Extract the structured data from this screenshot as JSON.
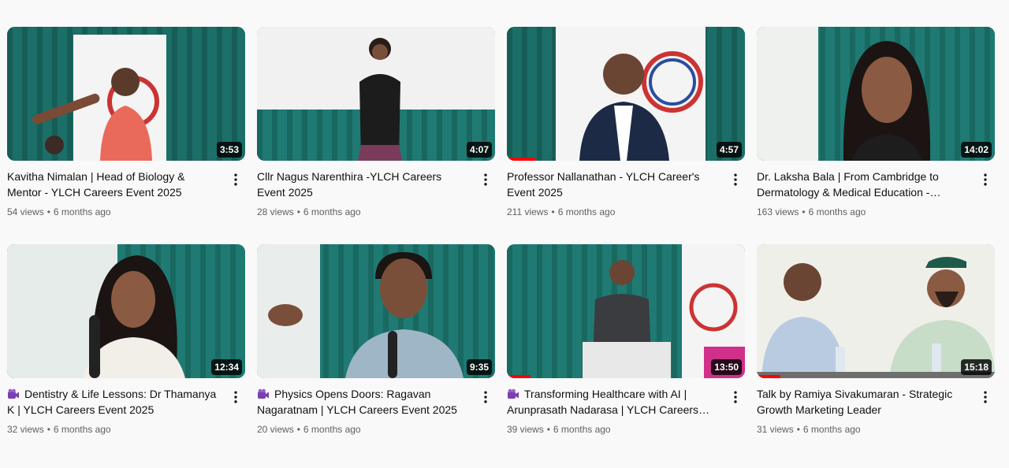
{
  "videos": [
    {
      "title": "Kavitha Nimalan | Head of Biology & Mentor - YLCH Careers Event 2025",
      "views": "54 views",
      "age": "6 months ago",
      "duration": "3:53",
      "has_badge": false,
      "progress": 0,
      "thumb_icon": "kavitha-thumbnail"
    },
    {
      "title": "Cllr Nagus Narenthira -YLCH Careers Event 2025",
      "views": "28 views",
      "age": "6 months ago",
      "duration": "4:07",
      "has_badge": false,
      "progress": 0,
      "thumb_icon": "nagus-thumbnail"
    },
    {
      "title": "Professor Nallanathan - YLCH Career's Event 2025",
      "views": "211 views",
      "age": "6 months ago",
      "duration": "4:57",
      "has_badge": false,
      "progress": 0.12,
      "thumb_icon": "nallanathan-thumbnail"
    },
    {
      "title": "Dr. Laksha Bala | From Cambridge to Dermatology & Medical Education - Career…",
      "views": "163 views",
      "age": "6 months ago",
      "duration": "14:02",
      "has_badge": false,
      "progress": 0,
      "thumb_icon": "laksha-thumbnail"
    },
    {
      "title": "Dentistry & Life Lessons: Dr Thamanya K | YLCH Careers Event 2025",
      "views": "32 views",
      "age": "6 months ago",
      "duration": "12:34",
      "has_badge": true,
      "progress": 0,
      "thumb_icon": "thamanya-thumbnail"
    },
    {
      "title": "Physics Opens Doors: Ragavan Nagaratnam | YLCH Careers Event 2025",
      "views": "20 views",
      "age": "6 months ago",
      "duration": "9:35",
      "has_badge": true,
      "progress": 0,
      "thumb_icon": "ragavan-thumbnail"
    },
    {
      "title": "Transforming Healthcare with AI | Arunprasath Nadarasa | YLCH Careers Eve…",
      "views": "39 views",
      "age": "6 months ago",
      "duration": "13:50",
      "has_badge": true,
      "progress": 0.1,
      "thumb_icon": "arunprasath-thumbnail"
    },
    {
      "title": "Talk by Ramiya Sivakumaran - Strategic Growth Marketing Leader",
      "views": "31 views",
      "age": "6 months ago",
      "duration": "15:18",
      "has_badge": false,
      "progress": 0.1,
      "thumb_icon": "ramiya-thumbnail"
    }
  ],
  "separator": "•",
  "colors": {
    "accent": "#ff0000",
    "curtain": "#1f7a73",
    "text": "#0f0f0f",
    "muted": "#606060"
  }
}
